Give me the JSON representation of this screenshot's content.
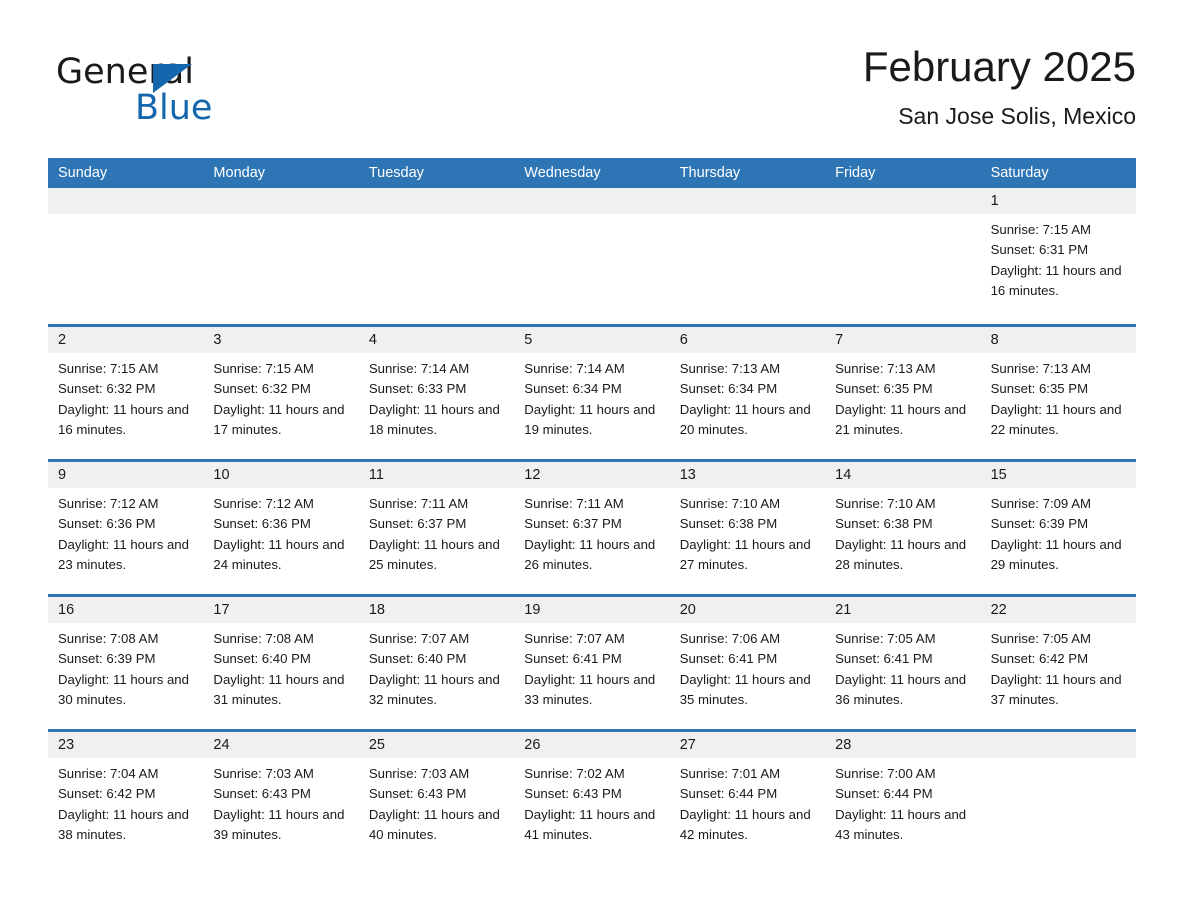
{
  "brand": {
    "word_one": "General",
    "word_two": "Blue",
    "triangle_icon": "triangle-icon"
  },
  "header": {
    "title": "February 2025",
    "subtitle": "San Jose Solis, Mexico",
    "accent_color": "#2e75b6",
    "brand_blue": "#1567ad"
  },
  "calendar": {
    "weekdays": [
      "Sunday",
      "Monday",
      "Tuesday",
      "Wednesday",
      "Thursday",
      "Friday",
      "Saturday"
    ],
    "weeks": [
      [
        {
          "day": "",
          "lines": []
        },
        {
          "day": "",
          "lines": []
        },
        {
          "day": "",
          "lines": []
        },
        {
          "day": "",
          "lines": []
        },
        {
          "day": "",
          "lines": []
        },
        {
          "day": "",
          "lines": []
        },
        {
          "day": "1",
          "lines": [
            "Sunrise: 7:15 AM",
            "Sunset: 6:31 PM",
            "Daylight: 11 hours and 16 minutes."
          ]
        }
      ],
      [
        {
          "day": "2",
          "lines": [
            "Sunrise: 7:15 AM",
            "Sunset: 6:32 PM",
            "Daylight: 11 hours and 16 minutes."
          ]
        },
        {
          "day": "3",
          "lines": [
            "Sunrise: 7:15 AM",
            "Sunset: 6:32 PM",
            "Daylight: 11 hours and 17 minutes."
          ]
        },
        {
          "day": "4",
          "lines": [
            "Sunrise: 7:14 AM",
            "Sunset: 6:33 PM",
            "Daylight: 11 hours and 18 minutes."
          ]
        },
        {
          "day": "5",
          "lines": [
            "Sunrise: 7:14 AM",
            "Sunset: 6:34 PM",
            "Daylight: 11 hours and 19 minutes."
          ]
        },
        {
          "day": "6",
          "lines": [
            "Sunrise: 7:13 AM",
            "Sunset: 6:34 PM",
            "Daylight: 11 hours and 20 minutes."
          ]
        },
        {
          "day": "7",
          "lines": [
            "Sunrise: 7:13 AM",
            "Sunset: 6:35 PM",
            "Daylight: 11 hours and 21 minutes."
          ]
        },
        {
          "day": "8",
          "lines": [
            "Sunrise: 7:13 AM",
            "Sunset: 6:35 PM",
            "Daylight: 11 hours and 22 minutes."
          ]
        }
      ],
      [
        {
          "day": "9",
          "lines": [
            "Sunrise: 7:12 AM",
            "Sunset: 6:36 PM",
            "Daylight: 11 hours and 23 minutes."
          ]
        },
        {
          "day": "10",
          "lines": [
            "Sunrise: 7:12 AM",
            "Sunset: 6:36 PM",
            "Daylight: 11 hours and 24 minutes."
          ]
        },
        {
          "day": "11",
          "lines": [
            "Sunrise: 7:11 AM",
            "Sunset: 6:37 PM",
            "Daylight: 11 hours and 25 minutes."
          ]
        },
        {
          "day": "12",
          "lines": [
            "Sunrise: 7:11 AM",
            "Sunset: 6:37 PM",
            "Daylight: 11 hours and 26 minutes."
          ]
        },
        {
          "day": "13",
          "lines": [
            "Sunrise: 7:10 AM",
            "Sunset: 6:38 PM",
            "Daylight: 11 hours and 27 minutes."
          ]
        },
        {
          "day": "14",
          "lines": [
            "Sunrise: 7:10 AM",
            "Sunset: 6:38 PM",
            "Daylight: 11 hours and 28 minutes."
          ]
        },
        {
          "day": "15",
          "lines": [
            "Sunrise: 7:09 AM",
            "Sunset: 6:39 PM",
            "Daylight: 11 hours and 29 minutes."
          ]
        }
      ],
      [
        {
          "day": "16",
          "lines": [
            "Sunrise: 7:08 AM",
            "Sunset: 6:39 PM",
            "Daylight: 11 hours and 30 minutes."
          ]
        },
        {
          "day": "17",
          "lines": [
            "Sunrise: 7:08 AM",
            "Sunset: 6:40 PM",
            "Daylight: 11 hours and 31 minutes."
          ]
        },
        {
          "day": "18",
          "lines": [
            "Sunrise: 7:07 AM",
            "Sunset: 6:40 PM",
            "Daylight: 11 hours and 32 minutes."
          ]
        },
        {
          "day": "19",
          "lines": [
            "Sunrise: 7:07 AM",
            "Sunset: 6:41 PM",
            "Daylight: 11 hours and 33 minutes."
          ]
        },
        {
          "day": "20",
          "lines": [
            "Sunrise: 7:06 AM",
            "Sunset: 6:41 PM",
            "Daylight: 11 hours and 35 minutes."
          ]
        },
        {
          "day": "21",
          "lines": [
            "Sunrise: 7:05 AM",
            "Sunset: 6:41 PM",
            "Daylight: 11 hours and 36 minutes."
          ]
        },
        {
          "day": "22",
          "lines": [
            "Sunrise: 7:05 AM",
            "Sunset: 6:42 PM",
            "Daylight: 11 hours and 37 minutes."
          ]
        }
      ],
      [
        {
          "day": "23",
          "lines": [
            "Sunrise: 7:04 AM",
            "Sunset: 6:42 PM",
            "Daylight: 11 hours and 38 minutes."
          ]
        },
        {
          "day": "24",
          "lines": [
            "Sunrise: 7:03 AM",
            "Sunset: 6:43 PM",
            "Daylight: 11 hours and 39 minutes."
          ]
        },
        {
          "day": "25",
          "lines": [
            "Sunrise: 7:03 AM",
            "Sunset: 6:43 PM",
            "Daylight: 11 hours and 40 minutes."
          ]
        },
        {
          "day": "26",
          "lines": [
            "Sunrise: 7:02 AM",
            "Sunset: 6:43 PM",
            "Daylight: 11 hours and 41 minutes."
          ]
        },
        {
          "day": "27",
          "lines": [
            "Sunrise: 7:01 AM",
            "Sunset: 6:44 PM",
            "Daylight: 11 hours and 42 minutes."
          ]
        },
        {
          "day": "28",
          "lines": [
            "Sunrise: 7:00 AM",
            "Sunset: 6:44 PM",
            "Daylight: 11 hours and 43 minutes."
          ]
        },
        {
          "day": "",
          "lines": []
        }
      ]
    ]
  }
}
